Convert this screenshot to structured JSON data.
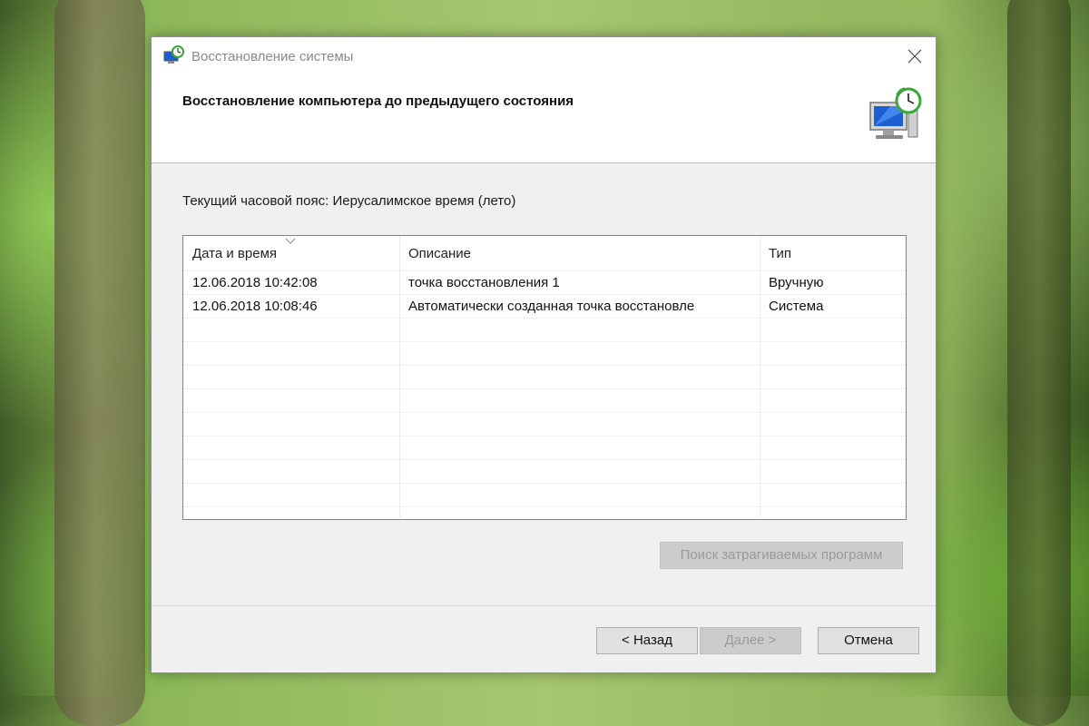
{
  "window": {
    "title": "Восстановление системы",
    "icons": {
      "app": "system-restore-icon",
      "close": "close-icon",
      "header": "computer-restore-icon"
    }
  },
  "header": {
    "title": "Восстановление компьютера до предыдущего состояния"
  },
  "timezone_label": "Текущий часовой пояс: Иерусалимское время (лето)",
  "list": {
    "columns": [
      "Дата и время",
      "Описание",
      "Тип"
    ],
    "sorted_column": "Дата и время",
    "rows": [
      {
        "datetime": "12.06.2018 10:42:08",
        "description": "точка восстановления 1",
        "type": "Вручную"
      },
      {
        "datetime": "12.06.2018 10:08:46",
        "description": "Автоматически созданная точка восстановле",
        "type": "Система"
      }
    ]
  },
  "buttons": {
    "search": "Поиск затрагиваемых программ",
    "back": "< Назад",
    "next": "Далее >",
    "cancel": "Отмена"
  },
  "colors": {
    "dialog_bg": "#f0f0f0",
    "disabled_text": "#9a9a9a",
    "restore_green": "#3aa63a",
    "screen_blue": "#1d5fd1"
  }
}
